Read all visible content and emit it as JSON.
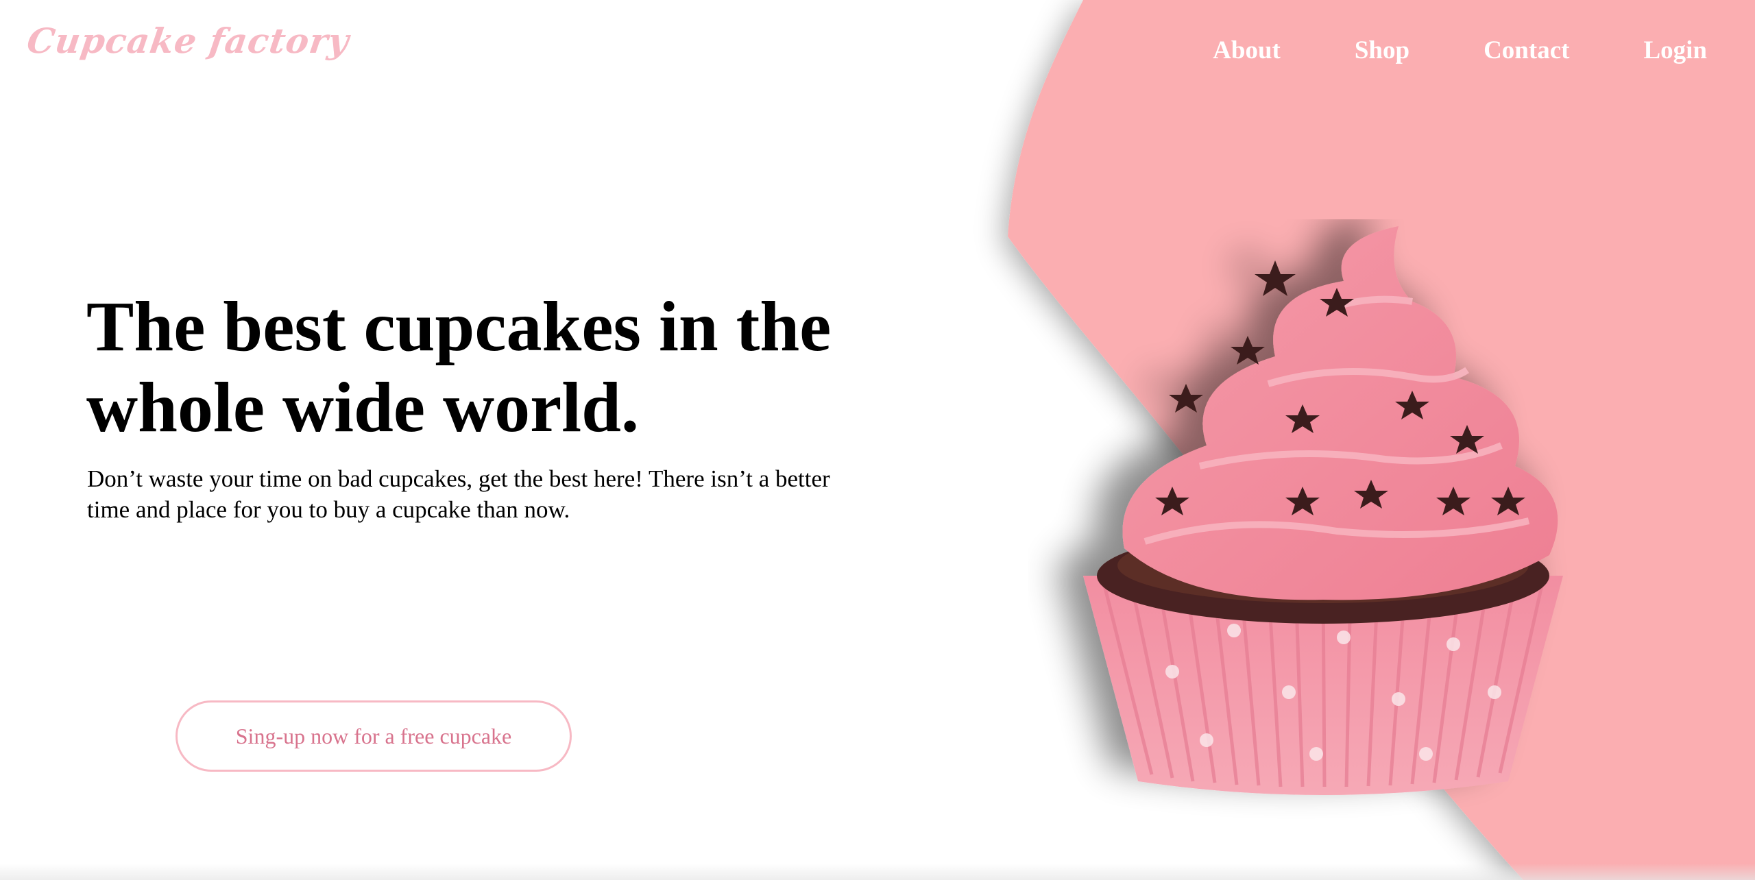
{
  "brand": {
    "logo_text": "Cupcake factory",
    "accent_color": "#f7b9c4",
    "panel_color": "#fbaeb1"
  },
  "nav": {
    "items": [
      {
        "label": "About"
      },
      {
        "label": "Shop"
      },
      {
        "label": "Contact"
      },
      {
        "label": "Login"
      }
    ]
  },
  "hero": {
    "title": "The best cupcakes in the whole wide world.",
    "subtitle": "Don’t waste your time on bad cupcakes, get the best here! There isn’t a better time and place for you to buy a cupcake than now.",
    "cta_label": "Sing-up now for a free cupcake",
    "image": "cupcake-image"
  }
}
